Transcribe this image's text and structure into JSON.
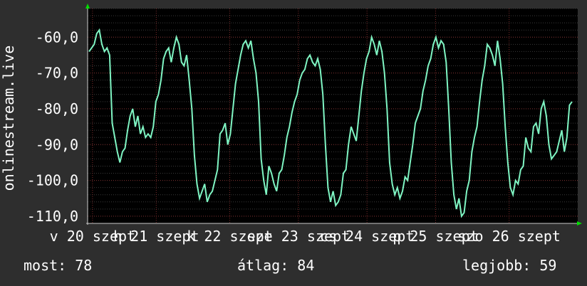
{
  "chart_data": {
    "type": "line",
    "ylabel": "onlinestream.live",
    "yticks": [
      "-60,0",
      "-70,0",
      "-80,0",
      "-90,0",
      "-100,0",
      "-110,0"
    ],
    "ylim": [
      -112,
      -52
    ],
    "x_tick_labels": [
      {
        "text": "v 20 szept",
        "pos": 0.01
      },
      {
        "text": "h 21 szept",
        "pos": 0.14
      },
      {
        "text": "k 22 szept",
        "pos": 0.29
      },
      {
        "text": "sze 23 szept",
        "pos": 0.43
      },
      {
        "text": "cs 24 szept",
        "pos": 0.57
      },
      {
        "text": "p 25 szept",
        "pos": 0.71
      },
      {
        "text": "szo 26 szept",
        "pos": 0.86
      }
    ],
    "grid": true,
    "series": [
      {
        "color": "#7ff5c3",
        "values": [
          -64,
          -63,
          -62,
          -59,
          -58,
          -62,
          -64,
          -63,
          -65,
          -84,
          -88,
          -92,
          -95,
          -92,
          -91,
          -86,
          -82,
          -80,
          -85,
          -82,
          -87,
          -85,
          -88,
          -87,
          -88,
          -85,
          -78,
          -76,
          -72,
          -66,
          -64,
          -63,
          -67,
          -63,
          -60,
          -62,
          -67,
          -68,
          -65,
          -72,
          -80,
          -93,
          -101,
          -105,
          -103,
          -101,
          -106,
          -104,
          -103,
          -100,
          -97,
          -87,
          -86,
          -84,
          -90,
          -87,
          -80,
          -73,
          -69,
          -65,
          -62,
          -61,
          -63,
          -61,
          -66,
          -70,
          -78,
          -94,
          -100,
          -104,
          -96,
          -98,
          -101,
          -103,
          -98,
          -97,
          -93,
          -88,
          -85,
          -81,
          -78,
          -76,
          -72,
          -70,
          -69,
          -66,
          -65,
          -67,
          -68,
          -66,
          -69,
          -76,
          -90,
          -102,
          -106,
          -103,
          -107,
          -106,
          -104,
          -98,
          -97,
          -90,
          -85,
          -87,
          -89,
          -82,
          -75,
          -70,
          -66,
          -64,
          -60,
          -62,
          -65,
          -61,
          -64,
          -70,
          -80,
          -95,
          -101,
          -104,
          -102,
          -105,
          -103,
          -99,
          -100,
          -95,
          -90,
          -84,
          -82,
          -80,
          -75,
          -72,
          -68,
          -66,
          -62,
          -60,
          -63,
          -61,
          -62,
          -67,
          -80,
          -95,
          -104,
          -108,
          -105,
          -110,
          -109,
          -103,
          -100,
          -92,
          -88,
          -85,
          -78,
          -72,
          -68,
          -62,
          -63,
          -65,
          -68,
          -61,
          -66,
          -73,
          -85,
          -95,
          -102,
          -104,
          -100,
          -101,
          -97,
          -96,
          -88,
          -91,
          -92,
          -85,
          -84,
          -87,
          -80,
          -78,
          -82,
          -90,
          -94,
          -93,
          -92,
          -89,
          -86,
          -92,
          -88,
          -79,
          -78
        ],
        "last": 78
      }
    ]
  },
  "stats": {
    "current": "most: 78",
    "average": "átlag: 84",
    "best": "legjobb: 59"
  }
}
